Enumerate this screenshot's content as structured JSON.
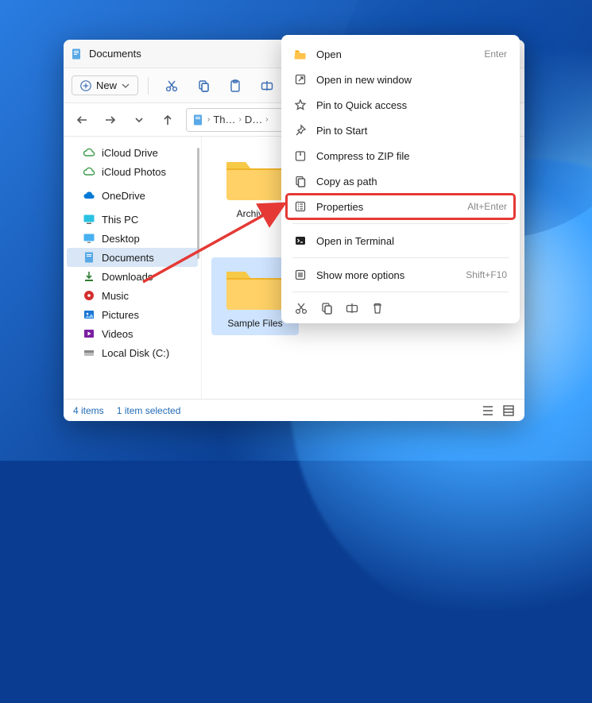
{
  "window": {
    "title": "Documents"
  },
  "toolbar": {
    "new_label": "New"
  },
  "breadcrumb": {
    "crumb1": "Th…",
    "crumb2": "D…"
  },
  "sidebar": {
    "items": [
      {
        "label": "iCloud Drive"
      },
      {
        "label": "iCloud Photos"
      },
      {
        "label": "OneDrive"
      },
      {
        "label": "This PC"
      },
      {
        "label": "Desktop"
      },
      {
        "label": "Documents"
      },
      {
        "label": "Downloads"
      },
      {
        "label": "Music"
      },
      {
        "label": "Pictures"
      },
      {
        "label": "Videos"
      },
      {
        "label": "Local Disk (C:)"
      }
    ]
  },
  "folders": [
    {
      "name": "Archived"
    },
    {
      "name": "Sample Files"
    }
  ],
  "status": {
    "count": "4 items",
    "selected": "1 item selected"
  },
  "context_menu": {
    "open": {
      "label": "Open",
      "accel": "Enter"
    },
    "open_new_window": {
      "label": "Open in new window"
    },
    "pin_quick": {
      "label": "Pin to Quick access"
    },
    "pin_start": {
      "label": "Pin to Start"
    },
    "zip": {
      "label": "Compress to ZIP file"
    },
    "copy_path": {
      "label": "Copy as path"
    },
    "properties": {
      "label": "Properties",
      "accel": "Alt+Enter"
    },
    "terminal": {
      "label": "Open in Terminal"
    },
    "more_options": {
      "label": "Show more options",
      "accel": "Shift+F10"
    }
  }
}
